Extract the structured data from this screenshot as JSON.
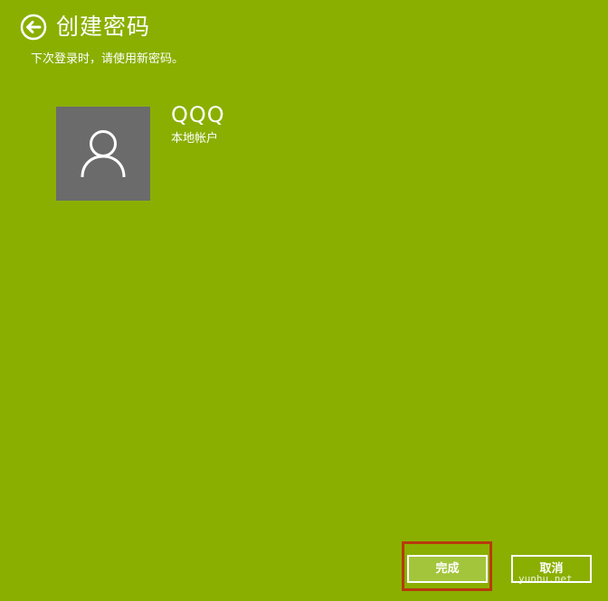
{
  "header": {
    "back_icon": "back-arrow-circle-icon",
    "title": "创建密码"
  },
  "subtitle": "下次登录时，请使用新密码。",
  "account": {
    "avatar_icon": "user-silhouette-icon",
    "name": "QQQ",
    "type": "本地帐户"
  },
  "buttons": {
    "finish_label": "完成",
    "cancel_label": "取消"
  },
  "watermark": "yunhu.net",
  "colors": {
    "background": "#8aaf00",
    "avatar_bg": "#6b6b6b",
    "finish_bg": "#a3c53c",
    "highlight": "#b83a0c",
    "text": "#ffffff"
  }
}
